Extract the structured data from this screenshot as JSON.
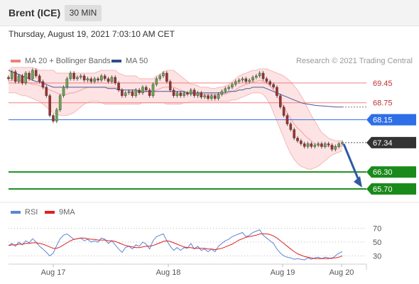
{
  "header": {
    "instrument": "Brent (ICE)",
    "timeframe": "30 MIN"
  },
  "datetime": "Thursday, August 19, 2021 7:03:10 AM CET",
  "legend": {
    "bollinger": "MA 20 + Bollinger Bands",
    "ma50": "MA 50"
  },
  "credit": "Research © 2021 Trading Central",
  "rsi_legend": {
    "rsi": "RSI",
    "ma": "9MA"
  },
  "colors": {
    "bollinger": "#f08080",
    "ma50": "#4a5aa0",
    "support": "#1a8a1a",
    "pivot": "#2e6fe8",
    "last": "#333333",
    "arrow": "#2e5aa0",
    "up_candle": "#6aa84f",
    "down_candle": "#a03030",
    "rsi": "#5b85d6",
    "rsi_ma": "#e02020"
  },
  "chart_data": [
    {
      "type": "candlestick",
      "x_labels": [
        "Aug 17",
        "Aug 18",
        "Aug 19",
        "Aug 20"
      ],
      "ylim": [
        65.3,
        70.0
      ],
      "price_levels": [
        {
          "value": "69.45",
          "kind": "resistance"
        },
        {
          "value": "68.75",
          "kind": "resistance"
        },
        {
          "value": "68.15",
          "kind": "pivot"
        },
        {
          "value": "67.34",
          "kind": "last"
        },
        {
          "value": "66.30",
          "kind": "support"
        },
        {
          "value": "65.70",
          "kind": "support"
        }
      ],
      "close": [
        69.6,
        69.85,
        69.5,
        69.7,
        69.45,
        69.8,
        69.6,
        69.9,
        69.7,
        69.5,
        69.3,
        69.0,
        68.3,
        68.1,
        68.5,
        69.0,
        69.3,
        69.6,
        69.8,
        69.6,
        69.65,
        69.7,
        69.55,
        69.6,
        69.5,
        69.6,
        69.55,
        69.7,
        69.6,
        69.5,
        69.65,
        69.45,
        69.2,
        69.0,
        69.1,
        69.15,
        69.0,
        69.2,
        69.1,
        69.3,
        69.2,
        69.0,
        69.4,
        69.6,
        69.7,
        69.8,
        69.5,
        69.2,
        69.0,
        69.1,
        69.0,
        69.1,
        69.05,
        69.2,
        69.0,
        69.1,
        68.95,
        69.0,
        68.9,
        69.0,
        68.9,
        69.05,
        69.15,
        69.25,
        69.3,
        69.4,
        69.5,
        69.55,
        69.6,
        69.5,
        69.55,
        69.65,
        69.7,
        69.8,
        69.6,
        69.5,
        69.4,
        69.3,
        69.0,
        68.6,
        68.3,
        68.0,
        67.8,
        67.5,
        67.4,
        67.3,
        67.2,
        67.3,
        67.2,
        67.25,
        67.3,
        67.2,
        67.3,
        67.25,
        67.1,
        67.2,
        67.3,
        67.34
      ],
      "ma20_upper": [
        69.9,
        70.0,
        70.0,
        70.0,
        70.0,
        70.0,
        70.0,
        70.0,
        69.95,
        69.9,
        69.9,
        69.9,
        69.9,
        69.9,
        69.8,
        69.8,
        69.8,
        69.8,
        69.8,
        69.8,
        69.8,
        69.8,
        69.8,
        69.8,
        69.8,
        69.8,
        69.85,
        69.9,
        69.9,
        69.9,
        69.9,
        69.9,
        69.8,
        69.75,
        69.7,
        69.7,
        69.7,
        69.7,
        69.6,
        69.6,
        69.6,
        69.6,
        69.6,
        69.7,
        69.75,
        69.85,
        69.9,
        69.9,
        69.9,
        69.8,
        69.7,
        69.6,
        69.5,
        69.4,
        69.4,
        69.35,
        69.3,
        69.3,
        69.3,
        69.25,
        69.25,
        69.3,
        69.3,
        69.35,
        69.4,
        69.5,
        69.6,
        69.7,
        69.75,
        69.8,
        69.85,
        69.9,
        69.9,
        69.95,
        69.95,
        69.95,
        69.9,
        69.85,
        69.8,
        69.75,
        69.7,
        69.6,
        69.5,
        69.35,
        69.2,
        69.0,
        68.8,
        68.55,
        68.3,
        68.1,
        67.9,
        67.7,
        67.6,
        67.5,
        67.45,
        67.4,
        67.4,
        67.4
      ],
      "ma20_lower": [
        69.1,
        69.1,
        69.1,
        69.05,
        69.0,
        69.0,
        68.95,
        68.9,
        68.85,
        68.8,
        68.7,
        68.6,
        68.5,
        68.4,
        68.35,
        68.3,
        68.3,
        68.3,
        68.35,
        68.4,
        68.5,
        68.6,
        68.7,
        68.75,
        68.8,
        68.8,
        68.8,
        68.75,
        68.7,
        68.7,
        68.7,
        68.7,
        68.7,
        68.7,
        68.7,
        68.7,
        68.7,
        68.7,
        68.7,
        68.75,
        68.75,
        68.75,
        68.75,
        68.75,
        68.75,
        68.75,
        68.7,
        68.7,
        68.7,
        68.7,
        68.7,
        68.75,
        68.75,
        68.8,
        68.8,
        68.8,
        68.8,
        68.8,
        68.8,
        68.8,
        68.8,
        68.8,
        68.8,
        68.8,
        68.8,
        68.85,
        68.85,
        68.9,
        68.95,
        69.0,
        69.05,
        69.1,
        69.1,
        69.1,
        69.05,
        68.9,
        68.7,
        68.4,
        68.1,
        67.8,
        67.5,
        67.2,
        66.95,
        66.75,
        66.6,
        66.5,
        66.45,
        66.4,
        66.4,
        66.45,
        66.5,
        66.6,
        66.7,
        66.8,
        66.9,
        66.95,
        67.0,
        67.05
      ],
      "ma20_mid": [
        69.5,
        69.55,
        69.55,
        69.55,
        69.5,
        69.5,
        69.45,
        69.4,
        69.4,
        69.35,
        69.3,
        69.25,
        69.2,
        69.15,
        69.1,
        69.05,
        69.05,
        69.05,
        69.1,
        69.1,
        69.15,
        69.2,
        69.25,
        69.3,
        69.3,
        69.3,
        69.3,
        69.3,
        69.3,
        69.3,
        69.3,
        69.3,
        69.25,
        69.2,
        69.2,
        69.2,
        69.2,
        69.2,
        69.15,
        69.15,
        69.15,
        69.15,
        69.15,
        69.2,
        69.25,
        69.3,
        69.3,
        69.3,
        69.3,
        69.25,
        69.2,
        69.15,
        69.1,
        69.1,
        69.05,
        69.05,
        69.05,
        69.05,
        69.05,
        69.05,
        69.05,
        69.05,
        69.05,
        69.05,
        69.1,
        69.15,
        69.2,
        69.3,
        69.35,
        69.4,
        69.45,
        69.5,
        69.5,
        69.55,
        69.5,
        69.45,
        69.35,
        69.2,
        69.0,
        68.8,
        68.6,
        68.4,
        68.2,
        68.0,
        67.85,
        67.75,
        67.6,
        67.5,
        67.4,
        67.3,
        67.25,
        67.2,
        67.2,
        67.2,
        67.2,
        67.2,
        67.2,
        67.2
      ],
      "ma50": [
        69.9,
        69.85,
        69.8,
        69.75,
        69.7,
        69.65,
        69.6,
        69.55,
        69.5,
        69.5,
        69.45,
        69.4,
        69.35,
        69.3,
        69.3,
        69.3,
        69.3,
        69.3,
        69.3,
        69.3,
        69.3,
        69.3,
        69.3,
        69.3,
        69.3,
        69.3,
        69.3,
        69.3,
        69.3,
        69.25,
        69.25,
        69.25,
        69.2,
        69.2,
        69.2,
        69.2,
        69.2,
        69.2,
        69.15,
        69.15,
        69.15,
        69.15,
        69.15,
        69.15,
        69.15,
        69.15,
        69.15,
        69.15,
        69.15,
        69.15,
        69.15,
        69.15,
        69.1,
        69.1,
        69.1,
        69.1,
        69.1,
        69.1,
        69.1,
        69.1,
        69.1,
        69.1,
        69.1,
        69.1,
        69.15,
        69.15,
        69.15,
        69.2,
        69.2,
        69.25,
        69.25,
        69.3,
        69.3,
        69.3,
        69.3,
        69.25,
        69.2,
        69.15,
        69.1,
        69.05,
        69.0,
        68.95,
        68.9,
        68.85,
        68.8,
        68.75,
        68.72,
        68.7,
        68.68,
        68.66,
        68.65,
        68.64,
        68.63,
        68.62,
        68.61,
        68.6,
        68.6,
        68.6
      ]
    },
    {
      "type": "line",
      "name": "RSI",
      "x_labels": [
        "Aug 17",
        "Aug 18",
        "Aug 19",
        "Aug 20"
      ],
      "y_ticks": [
        "70",
        "50",
        "30"
      ],
      "ylim": [
        20,
        80
      ],
      "series": [
        {
          "name": "RSI",
          "values": [
            45,
            48,
            44,
            50,
            46,
            52,
            49,
            55,
            50,
            44,
            40,
            35,
            30,
            34,
            45,
            55,
            60,
            62,
            58,
            54,
            55,
            56,
            52,
            54,
            50,
            52,
            50,
            56,
            54,
            48,
            52,
            46,
            40,
            35,
            42,
            44,
            40,
            46,
            44,
            50,
            47,
            40,
            52,
            58,
            60,
            62,
            52,
            44,
            38,
            42,
            38,
            42,
            41,
            48,
            40,
            44,
            38,
            40,
            36,
            40,
            36,
            44,
            48,
            52,
            54,
            58,
            60,
            62,
            64,
            58,
            60,
            64,
            66,
            68,
            60,
            56,
            52,
            48,
            40,
            34,
            30,
            28,
            27,
            25,
            26,
            25,
            24,
            27,
            25,
            27,
            28,
            26,
            28,
            27,
            26,
            30,
            34,
            36
          ]
        },
        {
          "name": "9MA",
          "values": [
            45,
            46,
            46,
            47,
            47,
            48,
            48,
            49,
            49,
            48,
            47,
            45,
            43,
            41,
            41,
            43,
            46,
            49,
            52,
            54,
            55,
            56,
            56,
            55,
            54,
            54,
            53,
            53,
            53,
            52,
            52,
            51,
            49,
            47,
            45,
            44,
            43,
            42,
            42,
            43,
            44,
            44,
            45,
            47,
            49,
            51,
            52,
            51,
            49,
            47,
            45,
            43,
            42,
            42,
            41,
            41,
            41,
            41,
            40,
            40,
            39,
            40,
            41,
            43,
            45,
            47,
            50,
            53,
            55,
            57,
            58,
            59,
            60,
            62,
            62,
            62,
            61,
            59,
            56,
            52,
            48,
            44,
            40,
            36,
            33,
            31,
            29,
            28,
            27,
            26,
            26,
            26,
            26,
            26,
            27,
            27,
            28,
            30
          ]
        }
      ]
    }
  ]
}
